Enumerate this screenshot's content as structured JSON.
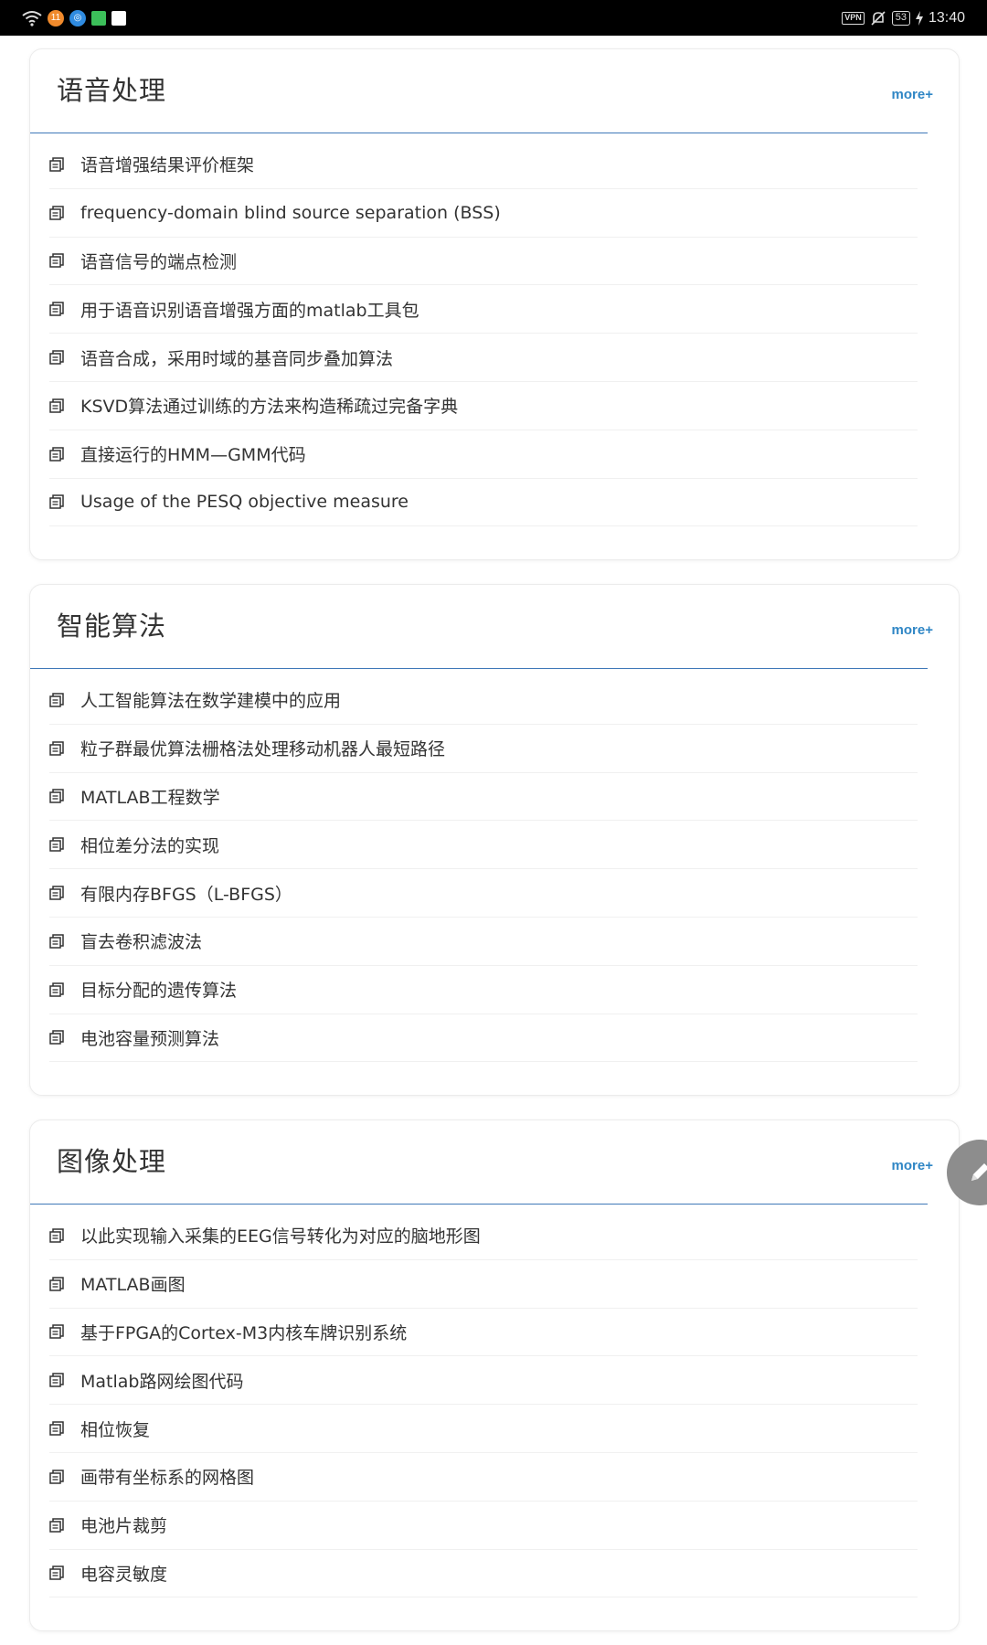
{
  "status_bar": {
    "time": "13:40",
    "battery": "53",
    "vpn_label": "VPN",
    "notification_count": "11",
    "icons": [
      "wifi-icon",
      "notification-badge-icon",
      "browser-icon",
      "app-icon",
      "app-icon-2",
      "vpn-icon",
      "mute-bell-icon",
      "battery-icon",
      "charging-icon"
    ]
  },
  "sections": [
    {
      "title": "语音处理",
      "more_label": "more+",
      "items": [
        "语音增强结果评价框架",
        "frequency-domain blind source separation (BSS)",
        "语音信号的端点检测",
        "用于语音识别语音增强方面的matlab工具包",
        "语音合成，采用时域的基音同步叠加算法",
        "KSVD算法通过训练的方法来构造稀疏过完备字典",
        "直接运行的HMM—GMM代码",
        "Usage of the PESQ objective measure"
      ]
    },
    {
      "title": "智能算法",
      "more_label": "more+",
      "items": [
        "人工智能算法在数学建模中的应用",
        "粒子群最优算法栅格法处理移动机器人最短路径",
        "MATLAB工程数学",
        "相位差分法的实现",
        "有限内存BFGS（L-BFGS）",
        "盲去卷积滤波法",
        "目标分配的遗传算法",
        "电池容量预测算法"
      ]
    },
    {
      "title": "图像处理",
      "more_label": "more+",
      "items": [
        "以此实现输入采集的EEG信号转化为对应的脑地形图",
        "MATLAB画图",
        "基于FPGA的Cortex-M3内核车牌识别系统",
        "Matlab路网绘图代码",
        "相位恢复",
        "画带有坐标系的网格图",
        "电池片裁剪",
        "电容灵敏度"
      ]
    }
  ],
  "fab": {
    "icon": "pencil-icon"
  },
  "colors": {
    "accent": "#2f86c5",
    "divider": "#3f78b8",
    "status_bar": "#000000",
    "text": "#333333",
    "fab": "#8d8d8d"
  }
}
